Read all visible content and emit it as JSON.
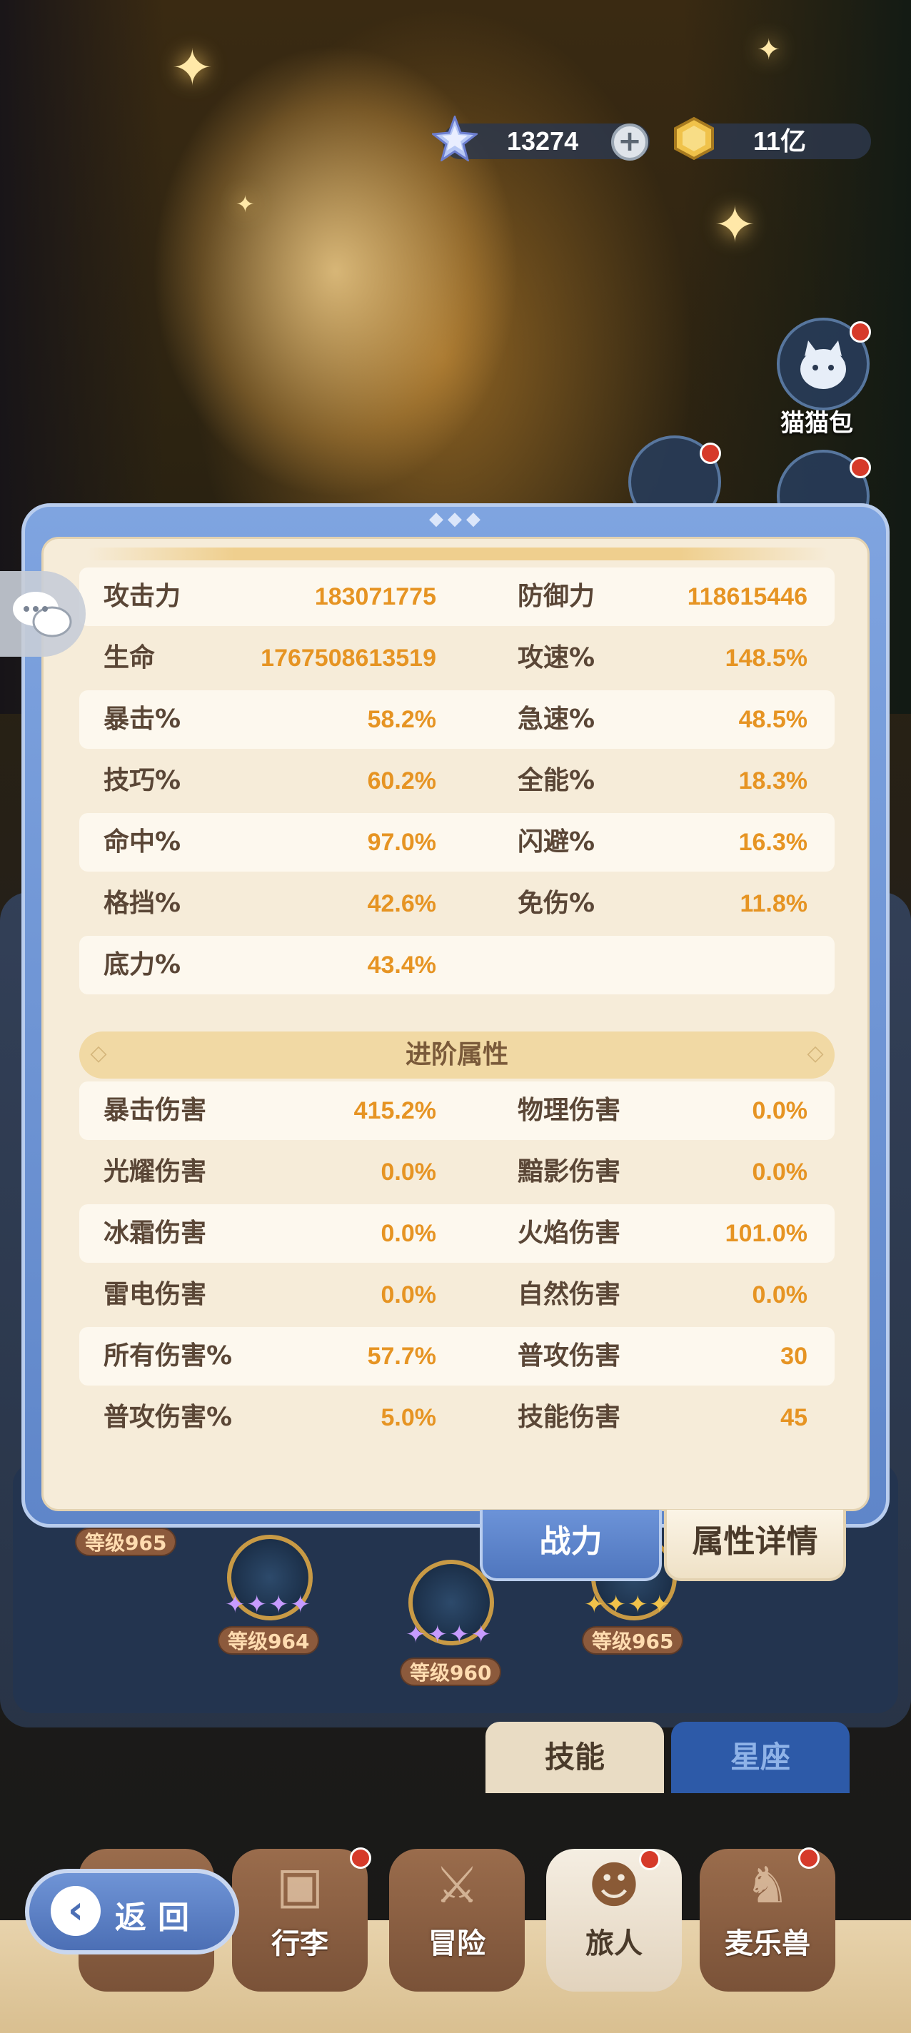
{
  "currency": {
    "gems": "13274",
    "gems_icon": "star-gem-icon",
    "gold": "11亿",
    "gold_icon": "gold-coin-icon"
  },
  "side_menu": {
    "cat_bag_label": "猫猫包"
  },
  "attributes": {
    "basic": [
      {
        "name1": "攻击力",
        "value1": "183071775",
        "name2": "防御力",
        "value2": "118615446"
      },
      {
        "name1": "生命",
        "value1": "1767508613519",
        "name2": "攻速%",
        "value2": "148.5%"
      },
      {
        "name1": "暴击%",
        "value1": "58.2%",
        "name2": "急速%",
        "value2": "48.5%"
      },
      {
        "name1": "技巧%",
        "value1": "60.2%",
        "name2": "全能%",
        "value2": "18.3%"
      },
      {
        "name1": "命中%",
        "value1": "97.0%",
        "name2": "闪避%",
        "value2": "16.3%"
      },
      {
        "name1": "格挡%",
        "value1": "42.6%",
        "name2": "免伤%",
        "value2": "11.8%"
      },
      {
        "name1": "底力%",
        "value1": "43.4%",
        "name2": "",
        "value2": ""
      }
    ],
    "advanced_title": "进阶属性",
    "advanced": [
      {
        "name1": "暴击伤害",
        "value1": "415.2%",
        "name2": "物理伤害",
        "value2": "0.0%"
      },
      {
        "name1": "光耀伤害",
        "value1": "0.0%",
        "name2": "黯影伤害",
        "value2": "0.0%"
      },
      {
        "name1": "冰霜伤害",
        "value1": "0.0%",
        "name2": "火焰伤害",
        "value2": "101.0%"
      },
      {
        "name1": "雷电伤害",
        "value1": "0.0%",
        "name2": "自然伤害",
        "value2": "0.0%"
      },
      {
        "name1": "所有伤害%",
        "value1": "57.7%",
        "name2": "普攻伤害",
        "value2": "30"
      },
      {
        "name1": "普攻伤害%",
        "value1": "5.0%",
        "name2": "技能伤害",
        "value2": "45"
      }
    ]
  },
  "modal_tabs": {
    "power": "战力",
    "detail": "属性详情"
  },
  "nodes": {
    "level_a": "等级965",
    "level_b": "等级964",
    "level_c": "等级960",
    "level_d": "等级965"
  },
  "panel_tabs": {
    "skill": "技能",
    "constellation": "星座"
  },
  "back_button": "返回",
  "bottom_nav": [
    {
      "label": "",
      "glyph": "crown-icon"
    },
    {
      "label": "行李",
      "glyph": "chest-icon"
    },
    {
      "label": "冒险",
      "glyph": "swords-icon"
    },
    {
      "label": "旅人",
      "glyph": "traveler-icon"
    },
    {
      "label": "麦乐兽",
      "glyph": "beast-icon"
    }
  ],
  "colors": {
    "value_orange": "#e69423",
    "modal_blue": "#6f94d6",
    "paper": "#f6ecd9"
  }
}
